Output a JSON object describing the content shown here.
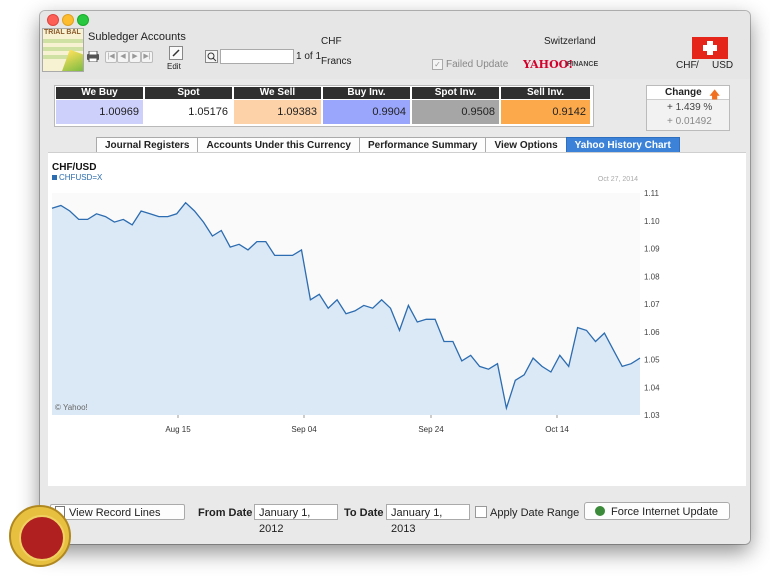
{
  "app": {
    "title": "Subledger Accounts",
    "edit_label": "Edit",
    "page_text": "1 of 1",
    "currency_code": "CHF",
    "currency_name": "Francs",
    "country": "Switzerland",
    "failed_update": "Failed Update",
    "provider": "YAHOO!",
    "provider_sub": "FINANCE",
    "pair_from": "CHF",
    "pair_sep": "/",
    "pair_to": "USD",
    "sheet_text": "TRIAL BAL"
  },
  "rates": {
    "headers": [
      "We Buy",
      "Spot",
      "We Sell",
      "Buy Inv.",
      "Spot Inv.",
      "Sell Inv."
    ],
    "values": [
      "1.00969",
      "1.05176",
      "1.09383",
      "0.9904",
      "0.9508",
      "0.9142"
    ],
    "colors": [
      "#cdd0fb",
      "#ffffff",
      "#fdd2a8",
      "#9aa6fb",
      "#a6a6a6",
      "#fba94b"
    ]
  },
  "change": {
    "label": "Change",
    "percent": "+ 1.439 %",
    "value": "+ 0.01492"
  },
  "tabs": [
    "Journal Registers",
    "Accounts Under this Currency",
    "Performance Summary",
    "View Options",
    "Yahoo History Chart"
  ],
  "chart_data": {
    "type": "area",
    "title": "CHF/USD",
    "legend": "CHFUSD=X",
    "date_label": "Oct 27, 2014",
    "copyright": "© Yahoo!",
    "x_ticks": [
      "Aug 15",
      "Sep 04",
      "Sep 24",
      "Oct 14"
    ],
    "y_ticks": [
      "1.11",
      "1.10",
      "1.09",
      "1.08",
      "1.07",
      "1.06",
      "1.05",
      "1.04",
      "1.03"
    ],
    "ylim": [
      1.03,
      1.11
    ],
    "series": [
      {
        "values": [
          1.1045,
          1.1055,
          1.1035,
          1.1005,
          1.1005,
          1.1025,
          1.1015,
          1.0995,
          1.1005,
          1.0985,
          1.1035,
          1.1025,
          1.1015,
          1.1015,
          1.1025,
          1.1065,
          1.1035,
          1.0995,
          1.0945,
          1.0965,
          1.0905,
          1.0915,
          1.0895,
          1.0925,
          1.0925,
          1.0875,
          1.0875,
          1.0875,
          1.0895,
          1.0715,
          1.0735,
          1.0685,
          1.0715,
          1.0665,
          1.0675,
          1.0695,
          1.0685,
          1.0715,
          1.0685,
          1.0605,
          1.0695,
          1.0635,
          1.0645,
          1.0645,
          1.0565,
          1.0565,
          1.0495,
          1.0515,
          1.0475,
          1.0465,
          1.0485,
          1.0325,
          1.0425,
          1.0445,
          1.0505,
          1.0475,
          1.0455,
          1.0515,
          1.0475,
          1.0615,
          1.0605,
          1.0565,
          1.0595,
          1.0535,
          1.0475,
          1.0485,
          1.0505
        ],
        "color": "#2c6cb0",
        "fill": "#dbe8f5"
      }
    ]
  },
  "bottom": {
    "view_lines": "View Record Lines",
    "from_label": "From Date",
    "from_value": "January 1, 2012",
    "to_label": "To Date",
    "to_value": "January 1, 2013",
    "apply_label": "Apply Date Range",
    "force_label": "Force Internet Update"
  }
}
